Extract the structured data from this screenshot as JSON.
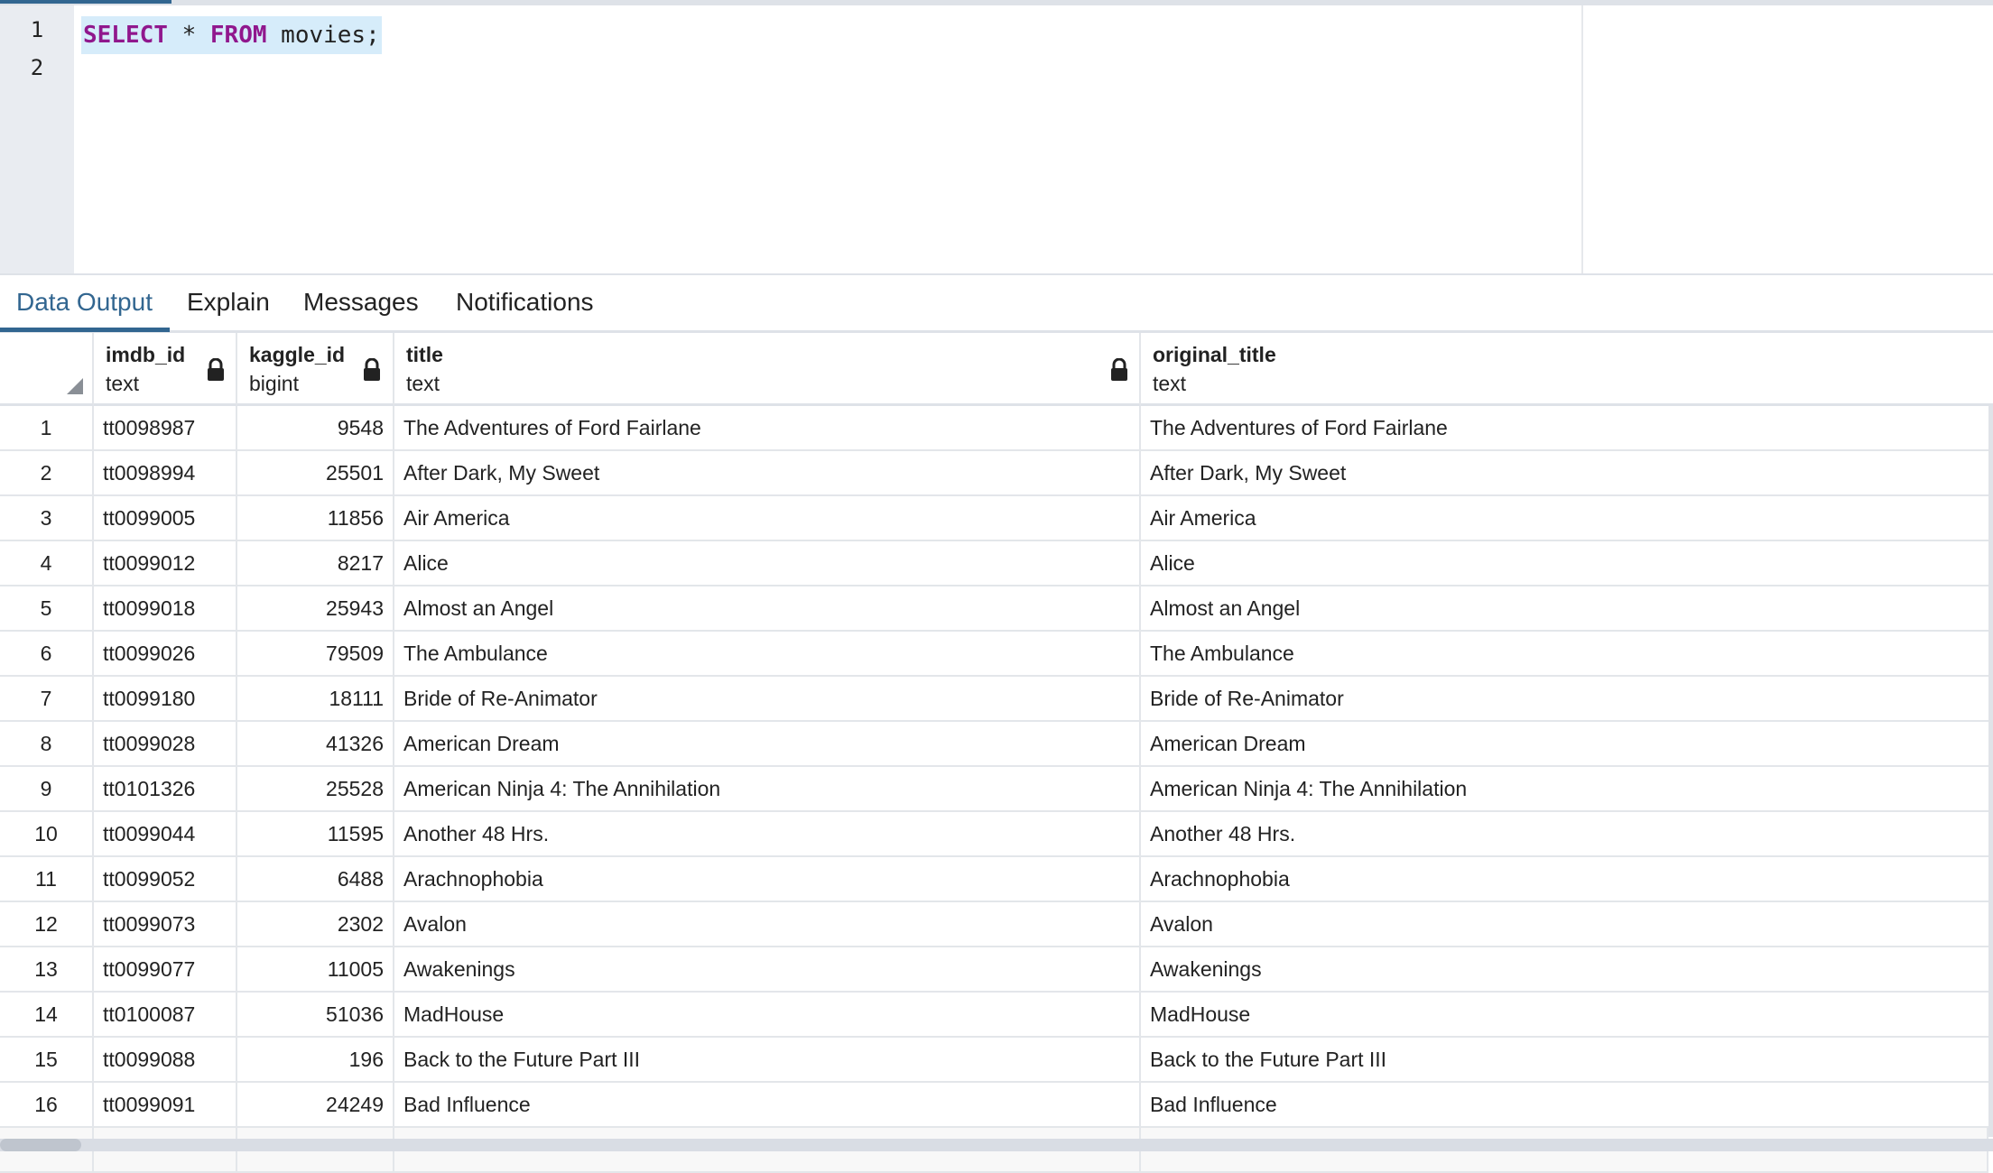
{
  "editor": {
    "lines": [
      "1",
      "2"
    ],
    "kw1": "SELECT",
    "mid": " * ",
    "kw2": "FROM",
    "rest": " movies;"
  },
  "tabs": [
    "Data Output",
    "Explain",
    "Messages",
    "Notifications"
  ],
  "columns": [
    {
      "name": "imdb_id",
      "type": "text"
    },
    {
      "name": "kaggle_id",
      "type": "bigint"
    },
    {
      "name": "title",
      "type": "text"
    },
    {
      "name": "original_title",
      "type": "text"
    }
  ],
  "rows": [
    [
      "1",
      "tt0098987",
      "9548",
      "The Adventures of Ford Fairlane",
      "The Adventures of Ford Fairlane"
    ],
    [
      "2",
      "tt0098994",
      "25501",
      "After Dark, My Sweet",
      "After Dark, My Sweet"
    ],
    [
      "3",
      "tt0099005",
      "11856",
      "Air America",
      "Air America"
    ],
    [
      "4",
      "tt0099012",
      "8217",
      "Alice",
      "Alice"
    ],
    [
      "5",
      "tt0099018",
      "25943",
      "Almost an Angel",
      "Almost an Angel"
    ],
    [
      "6",
      "tt0099026",
      "79509",
      "The Ambulance",
      "The Ambulance"
    ],
    [
      "7",
      "tt0099180",
      "18111",
      "Bride of Re-Animator",
      "Bride of Re-Animator"
    ],
    [
      "8",
      "tt0099028",
      "41326",
      "American Dream",
      "American Dream"
    ],
    [
      "9",
      "tt0101326",
      "25528",
      "American Ninja 4: The Annihilation",
      "American Ninja 4: The Annihilation"
    ],
    [
      "10",
      "tt0099044",
      "11595",
      "Another 48 Hrs.",
      "Another 48 Hrs."
    ],
    [
      "11",
      "tt0099052",
      "6488",
      "Arachnophobia",
      "Arachnophobia"
    ],
    [
      "12",
      "tt0099073",
      "2302",
      "Avalon",
      "Avalon"
    ],
    [
      "13",
      "tt0099077",
      "11005",
      "Awakenings",
      "Awakenings"
    ],
    [
      "14",
      "tt0100087",
      "51036",
      "MadHouse",
      "MadHouse"
    ],
    [
      "15",
      "tt0099088",
      "196",
      "Back to the Future Part III",
      "Back to the Future Part III"
    ],
    [
      "16",
      "tt0099091",
      "24249",
      "Bad Influence",
      "Bad Influence"
    ]
  ]
}
